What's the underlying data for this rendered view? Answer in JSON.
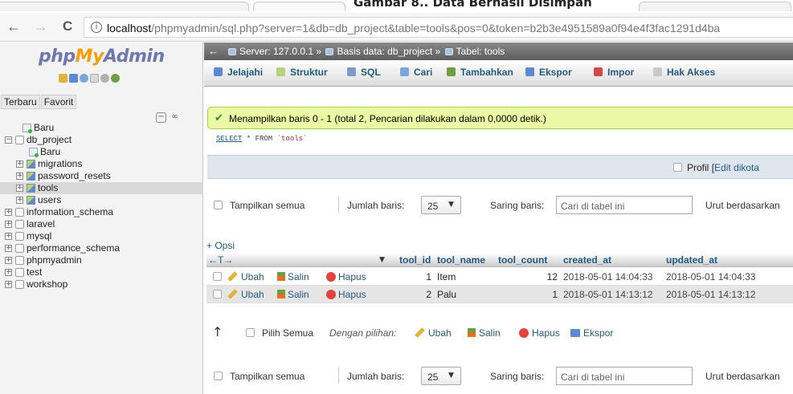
{
  "caption": "Gambar 8.. Data Berhasil Disimpan",
  "browser": {
    "back": "←",
    "forward": "→",
    "reload": "C",
    "info": "i",
    "url_host": "localhost",
    "url_path": "/phpmyadmin/sql.php?server=1&db=db_project&table=tools&pos=0&token=b2b3e4951589a0f94e4f3fac1291d4ba"
  },
  "sidebar": {
    "logo_php": "php",
    "logo_my": "My",
    "logo_admin": "Admin",
    "link_recent": "Terbaru",
    "link_favorite": "Favorit",
    "collapse": "−",
    "link": "∞",
    "tree": [
      {
        "label": "Baru",
        "depth": 1,
        "kind": "new",
        "expander": ""
      },
      {
        "label": "db_project",
        "depth": 0,
        "kind": "db",
        "expander": "−"
      },
      {
        "label": "Baru",
        "depth": 2,
        "kind": "new",
        "expander": ""
      },
      {
        "label": "migrations",
        "depth": 2,
        "kind": "tbl",
        "expander": "+"
      },
      {
        "label": "password_resets",
        "depth": 2,
        "kind": "tbl",
        "expander": "+"
      },
      {
        "label": "tools",
        "depth": 2,
        "kind": "tbl",
        "expander": "+",
        "active": true
      },
      {
        "label": "users",
        "depth": 2,
        "kind": "tbl",
        "expander": "+"
      },
      {
        "label": "information_schema",
        "depth": 0,
        "kind": "db",
        "expander": "+"
      },
      {
        "label": "laravel",
        "depth": 0,
        "kind": "db",
        "expander": "+"
      },
      {
        "label": "mysql",
        "depth": 0,
        "kind": "db",
        "expander": "+"
      },
      {
        "label": "performance_schema",
        "depth": 0,
        "kind": "db",
        "expander": "+"
      },
      {
        "label": "phpmyadmin",
        "depth": 0,
        "kind": "db",
        "expander": "+"
      },
      {
        "label": "test",
        "depth": 0,
        "kind": "db",
        "expander": "+"
      },
      {
        "label": "workshop",
        "depth": 0,
        "kind": "db",
        "expander": "+"
      }
    ]
  },
  "breadcrumb": {
    "back": "←",
    "server": "Server: 127.0.0.1",
    "sep": "»",
    "database": "Basis data: db_project",
    "table": "Tabel: tools"
  },
  "tabs": [
    {
      "label": "Jelajahi",
      "color": "#5b8ad3"
    },
    {
      "label": "Struktur",
      "color": "#b9d07a"
    },
    {
      "label": "SQL",
      "color": "#7a9cc6"
    },
    {
      "label": "Cari",
      "color": "#7aa7d9"
    },
    {
      "label": "Tambahkan",
      "color": "#6e9d42"
    },
    {
      "label": "Ekspor",
      "color": "#5b8ad3"
    },
    {
      "label": "Impor",
      "color": "#d04848"
    },
    {
      "label": "Hak Akses",
      "color": "#c9c9c9"
    }
  ],
  "notice": {
    "check": "✔",
    "text": "Menampilkan baris 0 - 1 (total 2, Pencarian dilakukan dalam 0,0000 detik.)"
  },
  "sql": {
    "select_kw": "SELECT",
    "rest": " * FROM ",
    "table": "`tools`"
  },
  "profiling": {
    "label": "Profil",
    "bracket": "[",
    "edit": "Edit dikota"
  },
  "nav_controls": {
    "show_all": "Tampilkan semua",
    "rows_label": "Jumlah baris:",
    "rows_value": "25",
    "dropdown_arrow": "▼",
    "filter_label": "Saring baris:",
    "filter_placeholder": "Cari di tabel ini",
    "sort_label": "Urut berdasarkan"
  },
  "options_link": "+ Opsi",
  "grid": {
    "nav_arrows": "←T→",
    "sort_marker": "▼",
    "columns": [
      "tool_id",
      "tool_name",
      "tool_count",
      "created_at",
      "updated_at"
    ],
    "actions": {
      "edit": "Ubah",
      "copy": "Salin",
      "delete": "Hapus"
    },
    "rows": [
      {
        "tool_id": "1",
        "tool_name": "Item",
        "tool_count": "12",
        "created_at": "2018-05-01 14:04:33",
        "updated_at": "2018-05-01 14:04:33"
      },
      {
        "tool_id": "2",
        "tool_name": "Palu",
        "tool_count": "1",
        "created_at": "2018-05-01 14:13:12",
        "updated_at": "2018-05-01 14:13:12"
      }
    ]
  },
  "bulk": {
    "arrow": "↑",
    "select_all": "Pilih Semua",
    "with_selected": "Dengan pilihan:",
    "edit": "Ubah",
    "copy": "Salin",
    "delete": "Hapus",
    "export": "Ekspor"
  }
}
